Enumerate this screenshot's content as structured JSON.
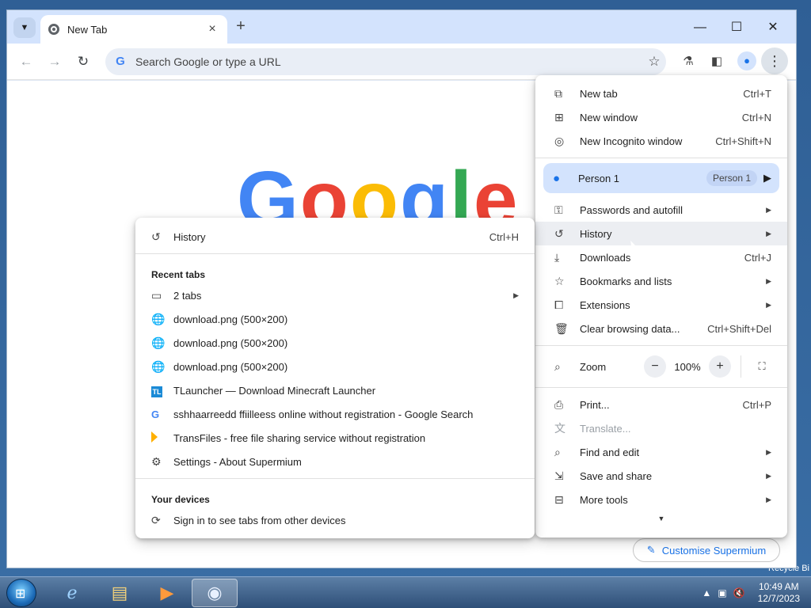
{
  "window": {
    "tab_title": "New Tab",
    "new_tab_symbol": "+",
    "omnibox_placeholder": "Search Google or type a URL"
  },
  "new_tab_page": {
    "doodle_letters": [
      "G",
      "o",
      "o",
      "g",
      "l",
      "e"
    ],
    "customise_label": "Customise Supermium"
  },
  "main_menu": {
    "items_top": [
      {
        "label": "New tab",
        "shortcut": "Ctrl+T",
        "icon": "new-tab-icon"
      },
      {
        "label": "New window",
        "shortcut": "Ctrl+N",
        "icon": "new-window-icon"
      },
      {
        "label": "New Incognito window",
        "shortcut": "Ctrl+Shift+N",
        "icon": "incognito-icon"
      }
    ],
    "person": {
      "label": "Person 1",
      "chip": "Person 1"
    },
    "items_mid": [
      {
        "label": "Passwords and autofill",
        "icon": "key-icon"
      },
      {
        "label": "History",
        "icon": "history-icon"
      },
      {
        "label": "Downloads",
        "shortcut": "Ctrl+J",
        "icon": "download-icon"
      },
      {
        "label": "Bookmarks and lists",
        "icon": "star-icon"
      },
      {
        "label": "Extensions",
        "icon": "extension-icon"
      },
      {
        "label": "Clear browsing data...",
        "shortcut": "Ctrl+Shift+Del",
        "icon": "trash-icon"
      }
    ],
    "zoom": {
      "label": "Zoom",
      "value": "100%",
      "minus": "−",
      "plus": "+"
    },
    "items_bottom": [
      {
        "label": "Print...",
        "shortcut": "Ctrl+P",
        "icon": "print-icon"
      },
      {
        "label": "Translate...",
        "icon": "translate-icon"
      },
      {
        "label": "Find and edit",
        "icon": "find-icon"
      },
      {
        "label": "Save and share",
        "icon": "save-icon"
      },
      {
        "label": "More tools",
        "icon": "toolbox-icon"
      }
    ]
  },
  "history_submenu": {
    "history": {
      "label": "History",
      "shortcut": "Ctrl+H"
    },
    "recent_tabs_heading": "Recent tabs",
    "recent": [
      {
        "label": "2 tabs",
        "icon": "window-icon"
      },
      {
        "label": "download.png (500×200)",
        "icon": "globe-icon"
      },
      {
        "label": "download.png (500×200)",
        "icon": "globe-icon"
      },
      {
        "label": "download.png (500×200)",
        "icon": "globe-icon"
      },
      {
        "label": "TLauncher — Download Minecraft Launcher",
        "icon": "tlauncher-icon"
      },
      {
        "label": "sshhaarreedd ffiilleess online without registration - Google Search",
        "icon": "google-icon"
      },
      {
        "label": "TransFiles - free file sharing service without registration",
        "icon": "transfiles-icon"
      },
      {
        "label": "Settings - About Supermium",
        "icon": "gear-icon"
      }
    ],
    "devices_heading": "Your devices",
    "devices_signin": "Sign in to see tabs from other devices"
  },
  "taskbar": {
    "time": "10:49 AM",
    "date": "12/7/2023"
  },
  "desktop": {
    "recycle_label": "Recycle Bi"
  },
  "colors": {
    "accent": "#1a73e8",
    "tabstrip": "#d3e3fd",
    "menu_highlight": "#d3e3fd"
  }
}
